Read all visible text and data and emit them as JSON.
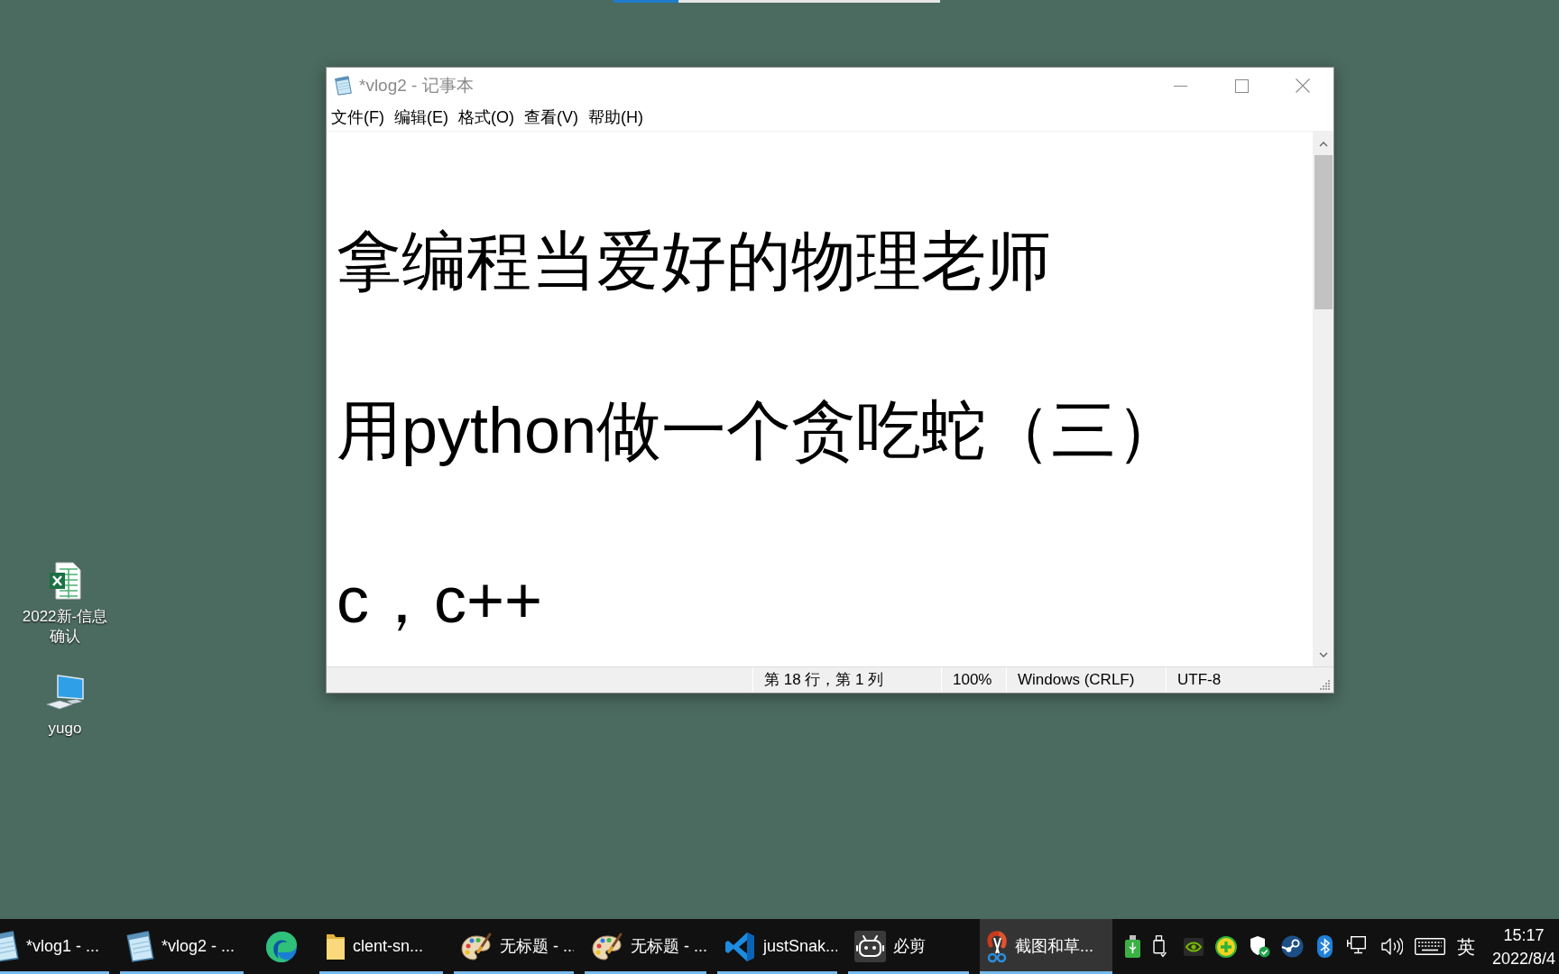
{
  "desktop": {
    "icons": [
      {
        "kind": "spreadsheet",
        "label": "2022新-信息确认"
      },
      {
        "kind": "computer",
        "label": "yugo"
      }
    ]
  },
  "notepad": {
    "title": "*vlog2 - 记事本",
    "menu": [
      "文件(F)",
      "编辑(E)",
      "格式(O)",
      "查看(V)",
      "帮助(H)"
    ],
    "lines": [
      "拿编程当爱好的物理老师",
      "用python做一个贪吃蛇（三）",
      "c，c++"
    ],
    "status_bar": [
      "第 18 行，第 1 列",
      "100%",
      "Windows (CRLF)",
      "UTF-8"
    ]
  },
  "taskbar": {
    "apps": [
      {
        "kind": "notepad",
        "label": "*vlog1 - ...",
        "running": true,
        "selected": false
      },
      {
        "kind": "notepad",
        "label": "*vlog2 - ...",
        "running": true,
        "selected": false
      },
      {
        "kind": "browser",
        "running": false,
        "selected": false
      },
      {
        "kind": "folder",
        "label": "clent-sn...",
        "running": true,
        "selected": false
      },
      {
        "kind": "paint",
        "label": "无标题 - ...",
        "running": true,
        "selected": false
      },
      {
        "kind": "paint",
        "label": "无标题 - ...",
        "running": true,
        "selected": false
      },
      {
        "kind": "code-editor",
        "label": "justSnak...",
        "running": true,
        "selected": false
      },
      {
        "kind": "video-editor",
        "label": "必剪",
        "running": true,
        "selected": false
      },
      {
        "kind": "snipping",
        "label": "截图和草...",
        "running": true,
        "selected": true
      }
    ],
    "ime": "英",
    "time": "15:17",
    "date": "2022/8/4"
  }
}
